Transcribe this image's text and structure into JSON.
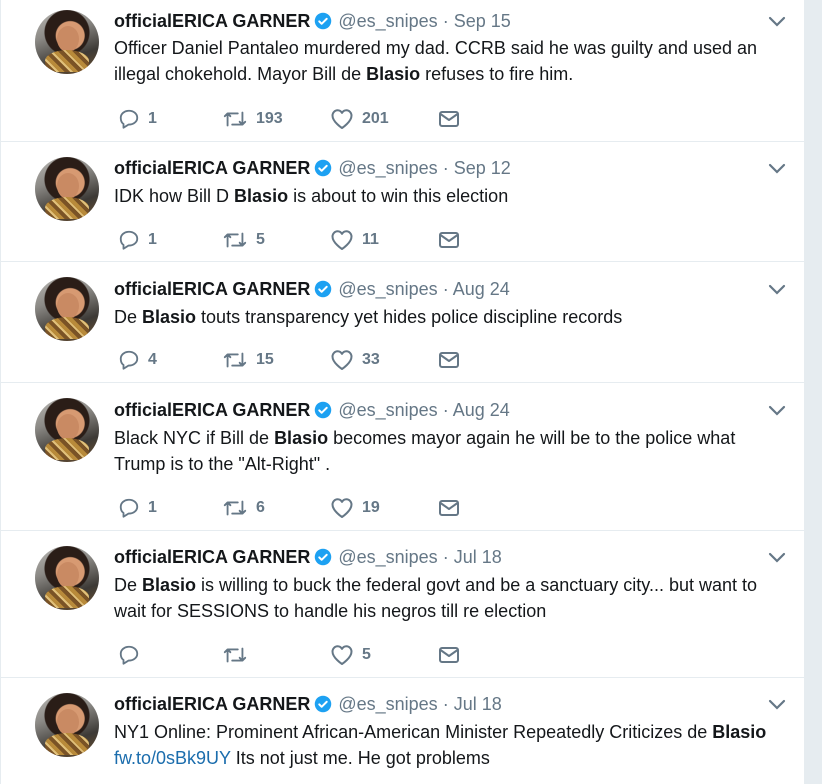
{
  "tweets": [
    {
      "name": "officialERICA GARNER",
      "handle": "@es_snipes",
      "separator": "·",
      "date": "Sep 15",
      "text_parts": [
        "Officer Daniel Pantaleo murdered my dad.  CCRB said he was guilty and used an",
        "illegal chokehold. Mayor Bill de ",
        "Blasio",
        " refuses to fire him."
      ],
      "replies": "1",
      "retweets": "193",
      "likes": "201"
    },
    {
      "name": "officialERICA GARNER",
      "handle": "@es_snipes",
      "separator": "·",
      "date": "Sep 12",
      "text_parts": [
        "IDK how Bill D ",
        "Blasio",
        " is about to win this election"
      ],
      "replies": "1",
      "retweets": "5",
      "likes": "11"
    },
    {
      "name": "officialERICA GARNER",
      "handle": "@es_snipes",
      "separator": "·",
      "date": "Aug 24",
      "text_parts": [
        "De ",
        "Blasio",
        " touts transparency yet hides police discipline records"
      ],
      "replies": "4",
      "retweets": "15",
      "likes": "33"
    },
    {
      "name": "officialERICA GARNER",
      "handle": "@es_snipes",
      "separator": "·",
      "date": "Aug 24",
      "text_parts": [
        "Black NYC if Bill de ",
        "Blasio",
        " becomes mayor again he will be to the police what",
        "Trump is to the \"Alt-Right\" ."
      ],
      "replies": "1",
      "retweets": "6",
      "likes": "19"
    },
    {
      "name": "officialERICA GARNER",
      "handle": "@es_snipes",
      "separator": "·",
      "date": "Jul 18",
      "text_parts": [
        "De ",
        "Blasio",
        " is willing to buck the federal govt and be a sanctuary city... but want to",
        "wait for SESSIONS to handle his negros till re election"
      ],
      "replies": "",
      "retweets": "",
      "likes": "5"
    },
    {
      "name": "officialERICA GARNER",
      "handle": "@es_snipes",
      "separator": "·",
      "date": "Jul 18",
      "text_parts": [
        "NY1 Online: Prominent African-American Minister Repeatedly Criticizes de ",
        "Blasio",
        "fw.to/0sBk9UY",
        "  Its not just me. He got problems"
      ],
      "replies": "",
      "retweets": "",
      "likes": ""
    }
  ],
  "icons": {
    "reply": "reply-icon",
    "retweet": "retweet-icon",
    "like": "heart-icon",
    "mail": "direct-message-icon",
    "verified": "verified-badge-icon",
    "more": "chevron-down-icon"
  },
  "colors": {
    "text": "#14171a",
    "muted": "#657786",
    "link": "#1b6dad",
    "verified": "#1da1f2",
    "divider": "#e6ecf0"
  }
}
